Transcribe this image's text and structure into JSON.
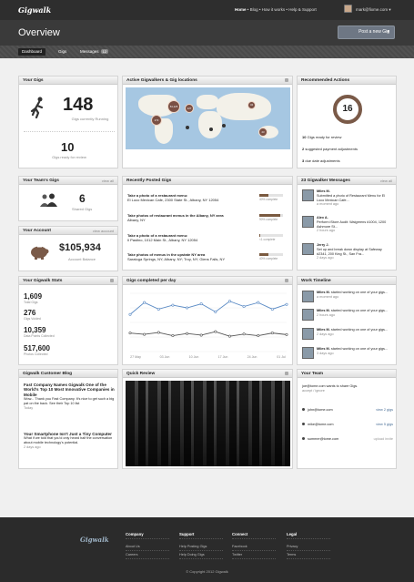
{
  "topbar": {
    "logo": "Gigwalk",
    "nav": {
      "home": "Home",
      "rest": " • Blog • How it works • Help & Support"
    },
    "email": "mark@fixme.com ▾"
  },
  "header": {
    "title": "Overview",
    "post_button": "Post a new Gig",
    "post_caret": "▾"
  },
  "subtabs": [
    {
      "label": "Dashboard"
    },
    {
      "label": "Gigs"
    },
    {
      "label": "Messages",
      "badge": "12"
    }
  ],
  "your_gigs": {
    "title": "Your Gigs",
    "running_count": "148",
    "running_label": "Gigs currently Running",
    "review_count": "10",
    "review_label": "Gigs ready for review"
  },
  "map": {
    "title": "Active Gigwalkers & Gig locations",
    "clusters": [
      "172",
      "54,125",
      "127",
      "34",
      "216",
      "23"
    ]
  },
  "recommended": {
    "title": "Recommended Actions",
    "ring_value": "16",
    "actions": [
      {
        "count": "10",
        "text": "Gigs ready for review"
      },
      {
        "count": "2",
        "text": "suggested payment adjustments"
      },
      {
        "count": "3",
        "text": "due date adjustments"
      }
    ]
  },
  "team_gigs": {
    "title": "Your Team's Gigs",
    "view_all": "view all",
    "count": "6",
    "label": "Shared Gigs"
  },
  "recent": {
    "title": "Recently Posted Gigs",
    "items": [
      {
        "title": "Take a photo of a restaurant menu:",
        "addr": "El Loco Mexican Cafe, 2300 State St., Albany, NY 12054",
        "pct": "40% complete",
        "fill": 0.4
      },
      {
        "title": "Take photos of restaurant menus in the Albany, NY area",
        "addr": "Albany, NY",
        "pct": "90% complete",
        "fill": 0.9
      },
      {
        "title": "Take a photo of a restaurant menu:",
        "addr": "Il Pastino, 1012 Main St., Albany, NY 12054",
        "pct": "<1 complete",
        "fill": 0.05
      },
      {
        "title": "Take photos of menus in the upstate NY area",
        "addr": "Saratoga Springs, NY; Albany, NY; Troy, NY; Glens Falls, NY",
        "pct": "40% complete",
        "fill": 0.4
      }
    ]
  },
  "messages": {
    "title": "23 Gigwalker Messages",
    "view_all": "view all",
    "items": [
      {
        "name": "Miles M.",
        "text": "Submitted a photo of Restaurant Menu for El Loco Mexican Cafe...",
        "time": "a moment ago"
      },
      {
        "name": "Alex A.",
        "text": "Perform iStore Audit: Walgreens #1004, 1200 Ashmore St...",
        "time": "2 hours ago"
      },
      {
        "name": "Jerry J.",
        "text": "Set up and break down display at Safeway #2341, 200 King St., San Fra...",
        "time": "2 days ago"
      }
    ]
  },
  "account": {
    "title": "Your Account",
    "view_account": "view account",
    "balance": "$105,934",
    "label": "Account Balance"
  },
  "stats": {
    "title": "Your Gigwalk Stats",
    "items": [
      {
        "n": "1,609",
        "l": "Total Gigs"
      },
      {
        "n": "276",
        "l": "Gigs Voided"
      },
      {
        "n": "10,359",
        "l": "Data Points Collected"
      },
      {
        "n": "517,600",
        "l": "Photos Collected"
      }
    ]
  },
  "chart_data": {
    "type": "line",
    "title": "Gigs completed per day",
    "categories": [
      "27 May",
      "03 Jun",
      "10 Jun",
      "17 Jun",
      "24 Jun",
      "01 Jul"
    ],
    "series": [
      {
        "values": [
          140,
          185,
          160,
          175,
          165,
          180,
          150,
          190,
          170,
          185,
          160,
          178
        ]
      },
      {
        "values": [
          70,
          65,
          72,
          60,
          68,
          62,
          75,
          58,
          66,
          60,
          70,
          64
        ]
      }
    ],
    "ylim": [
      0,
      220
    ]
  },
  "timeline": {
    "title": "Work Timeline",
    "items": [
      {
        "name": "Miles M.",
        "text": " started working on one of your gigs...",
        "time": "a moment ago"
      },
      {
        "name": "Miles M.",
        "text": " started working on one of your gigs...",
        "time": "2 hours ago"
      },
      {
        "name": "Miles M.",
        "text": " started working on one of your gigs...",
        "time": "2 days ago"
      },
      {
        "name": "Miles M.",
        "text": " started working on one of your gigs...",
        "time": "3 days ago"
      }
    ]
  },
  "blog": {
    "title": "Gigwalk Customer Blog",
    "posts": [
      {
        "head": "Fast Company Names Gigwalk One of the World's Top 10 Most Innovative Companies in Mobile",
        "body": "Wow... Thank you Fast Company. It's nice to get such a big pat on the back. See their Top 10 list",
        "time": "Today"
      },
      {
        "head": "Your Smartphone Isn't Just a Tiny Computer",
        "body": "What if we told that you'd only heard half the conversation about mobile technology's potential.",
        "time": "2 days ago"
      }
    ]
  },
  "review": {
    "title": "Quick Review"
  },
  "team": {
    "title": "Your Team",
    "invite": "joe@tome.com wants to share Gigs.",
    "accept": "accept / ignore",
    "members": [
      {
        "email": "john@tome.com",
        "link": "view 2 gigs"
      },
      {
        "email": "mike@tome.com",
        "link": "view 5 gigs"
      },
      {
        "email": "summer@tome.com",
        "link": "upload invite"
      }
    ]
  },
  "footer": {
    "logo": "Gigwalk",
    "cols": [
      {
        "head": "Company",
        "links": [
          "About Us",
          "Careers"
        ]
      },
      {
        "head": "Support",
        "links": [
          "Help Posting Gigs",
          "Help Doing Gigs"
        ]
      },
      {
        "head": "Connect",
        "links": [
          "Facebook",
          "Twitter"
        ]
      },
      {
        "head": "Legal",
        "links": [
          "Privacy",
          "Terms"
        ]
      }
    ],
    "copyright": "© Copyright 2012 Gigwalk"
  }
}
